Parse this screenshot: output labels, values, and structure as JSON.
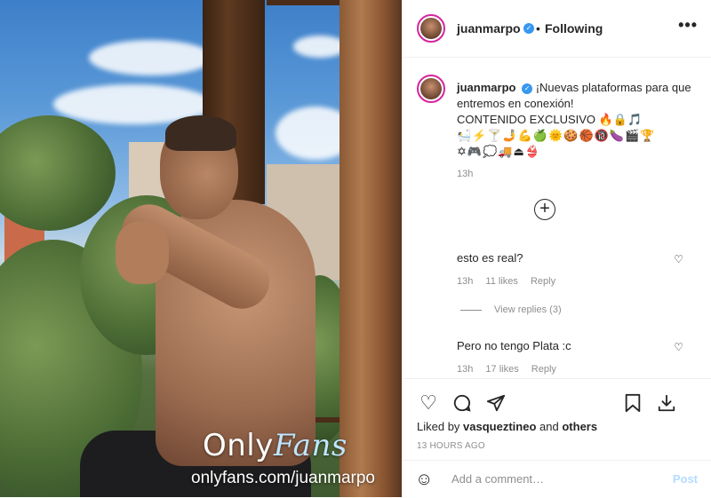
{
  "post": {
    "username": "juanmarpo",
    "follow_status": "Following",
    "more_label": "•••",
    "verified_icon": "verified-badge-icon"
  },
  "caption": {
    "username": "juanmarpo",
    "line1": "¡Nuevas plataformas para que entremos en conexión!",
    "line2": "CONTENIDO EXCLUSIVO 🔥🔒🎵",
    "emoji_row1": "🛀⚡🍸🤳💪🍏🌞🍪🏀🔞🍆🎬🏆",
    "emoji_row2": "✡🎮💭🚚⏏👙",
    "time": "13h"
  },
  "load_more": "+",
  "comments": [
    {
      "text": "esto es real?",
      "time": "13h",
      "likes": "11 likes",
      "reply": "Reply"
    },
    {
      "text": "Pero no tengo Plata :c",
      "time": "13h",
      "likes": "17 likes",
      "reply": "Reply"
    }
  ],
  "view_replies": "View replies (3)",
  "liked_by": {
    "prefix": "Liked by",
    "user": "vasqueztineo",
    "and": "and",
    "others": "others"
  },
  "post_age": "13 HOURS AGO",
  "add_comment": {
    "placeholder": "Add a comment…",
    "post_label": "Post"
  },
  "watermark": {
    "brand_only": "Only",
    "brand_fans": "Fans",
    "url": "onlyfans.com/juanmarpo"
  },
  "colors": {
    "verified": "#3897f0",
    "story_ring": "#d6249f",
    "post_disabled": "#b3dbff",
    "muted": "#8e8e8e"
  }
}
